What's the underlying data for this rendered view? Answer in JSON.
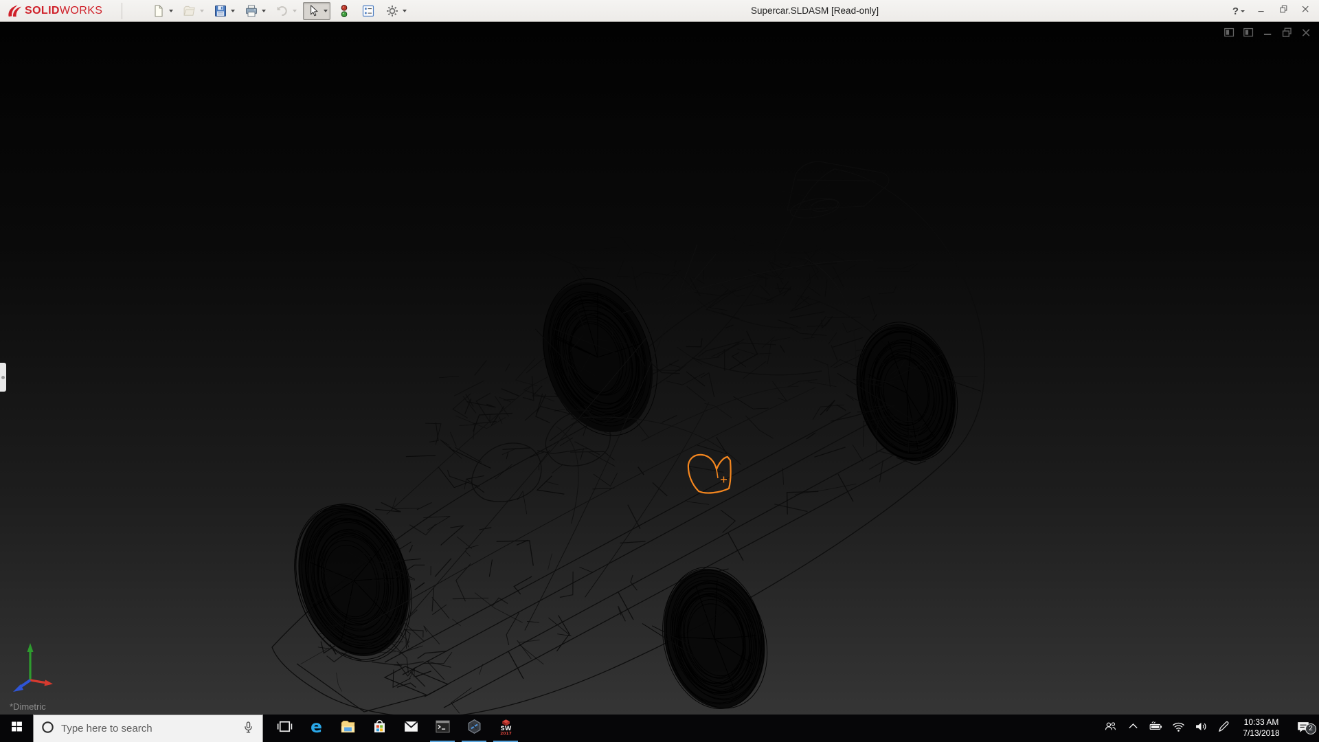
{
  "titlebar": {
    "brand": {
      "bold": "SOLID",
      "light": "WORKS",
      "color": "#cf2029"
    },
    "document_title": "Supercar.SLDASM [Read-only]",
    "help_glyph": "?",
    "window_controls": [
      {
        "name": "help",
        "icon": "help"
      },
      {
        "name": "minimize",
        "icon": "minimize"
      },
      {
        "name": "restore",
        "icon": "restore"
      },
      {
        "name": "close",
        "icon": "close"
      }
    ]
  },
  "toolbar": {
    "items": [
      {
        "name": "new-document",
        "icon": "new-document",
        "dropdown": true,
        "disabled": false,
        "active": false
      },
      {
        "name": "open",
        "icon": "open-folder",
        "dropdown": true,
        "disabled": true,
        "active": false
      },
      {
        "name": "save",
        "icon": "save-floppy",
        "dropdown": true,
        "disabled": false,
        "active": false
      },
      {
        "name": "print",
        "icon": "print",
        "dropdown": true,
        "disabled": false,
        "active": false
      },
      {
        "name": "undo",
        "icon": "undo",
        "dropdown": true,
        "disabled": true,
        "active": false
      },
      {
        "name": "select",
        "icon": "select-cursor",
        "dropdown": true,
        "disabled": false,
        "active": true
      },
      {
        "name": "rebuild-traffic-light",
        "icon": "traffic-light",
        "dropdown": false,
        "disabled": false,
        "active": false
      },
      {
        "name": "file-properties",
        "icon": "properties-list",
        "dropdown": false,
        "disabled": false,
        "active": false
      },
      {
        "name": "options",
        "icon": "gear",
        "dropdown": true,
        "disabled": false,
        "active": false
      }
    ]
  },
  "viewport": {
    "view_label": "*Dimetric",
    "selection_color": "#f5871f",
    "background_top": "#020202",
    "background_bottom": "#353535",
    "edge_color": "#0d0d0d",
    "triad": {
      "x_color": "#d63a2f",
      "y_color": "#2e9b2e",
      "z_color": "#2f55d6"
    },
    "window_controls": [
      {
        "name": "pane-left",
        "icon": "vp-pane"
      },
      {
        "name": "pane-right",
        "icon": "vp-pane"
      },
      {
        "name": "minimize",
        "icon": "vp-minimize"
      },
      {
        "name": "restore",
        "icon": "vp-restore"
      },
      {
        "name": "close",
        "icon": "vp-close"
      }
    ]
  },
  "taskbar": {
    "search_placeholder": "Type here to search",
    "apps": [
      {
        "name": "task-view",
        "icon": "task-view",
        "running": false
      },
      {
        "name": "edge",
        "icon": "edge",
        "running": false
      },
      {
        "name": "file-explorer",
        "icon": "explorer",
        "running": false
      },
      {
        "name": "microsoft-store",
        "icon": "store",
        "running": false
      },
      {
        "name": "mail",
        "icon": "mail",
        "running": false
      },
      {
        "name": "command-prompt",
        "icon": "cmd",
        "running": true
      },
      {
        "name": "hexagon-app",
        "icon": "hexagon",
        "running": true
      },
      {
        "name": "solidworks-2017",
        "icon": "solidworks",
        "running": true
      }
    ],
    "tray_icons": [
      {
        "name": "people",
        "icon": "people"
      },
      {
        "name": "hidden-icons-chevron",
        "icon": "chevron-up"
      },
      {
        "name": "battery-charging",
        "icon": "battery"
      },
      {
        "name": "wifi",
        "icon": "wifi"
      },
      {
        "name": "volume",
        "icon": "volume"
      },
      {
        "name": "windows-ink",
        "icon": "pen"
      }
    ],
    "clock": {
      "time": "10:33 AM",
      "date": "7/13/2018"
    },
    "notification_count": "2",
    "running_underline_color": "#5aa7e0"
  }
}
